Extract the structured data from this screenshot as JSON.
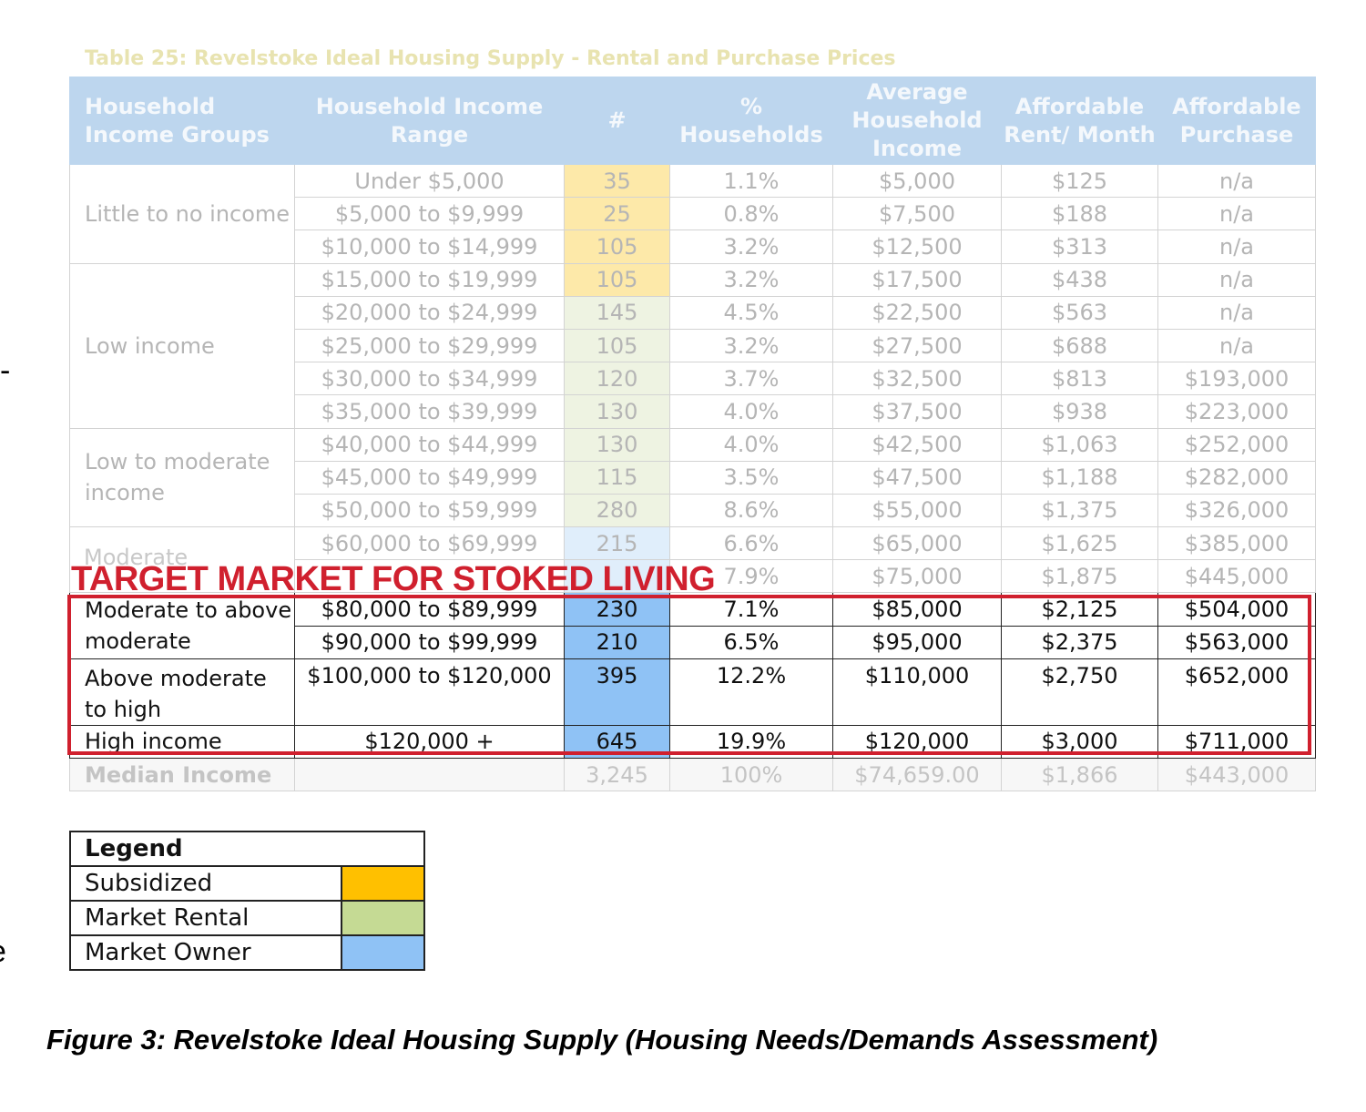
{
  "table_title": "Table 25: Revelstoke Ideal Housing Supply - Rental and Purchase Prices",
  "headers": [
    "Household Income Groups",
    "Household Income Range",
    "#",
    "% Households",
    "Average Household Income",
    "Affordable Rent/ Month",
    "Affordable Purchase"
  ],
  "groups": {
    "little": "Little to no income",
    "low": "Low income",
    "lowmod": "Low to moderate income",
    "moderate": "Moderate",
    "modabove": "Moderate to above moderate",
    "abovehigh": "Above moderate to high",
    "high": "High income"
  },
  "rows": [
    {
      "range": "Under $5,000",
      "count": "35",
      "pct": "1.1%",
      "avg": "$5,000",
      "rent": "$125",
      "purchase": "n/a"
    },
    {
      "range": "$5,000 to $9,999",
      "count": "25",
      "pct": "0.8%",
      "avg": "$7,500",
      "rent": "$188",
      "purchase": "n/a"
    },
    {
      "range": "$10,000 to $14,999",
      "count": "105",
      "pct": "3.2%",
      "avg": "$12,500",
      "rent": "$313",
      "purchase": "n/a"
    },
    {
      "range": "$15,000 to $19,999",
      "count": "105",
      "pct": "3.2%",
      "avg": "$17,500",
      "rent": "$438",
      "purchase": "n/a"
    },
    {
      "range": "$20,000 to $24,999",
      "count": "145",
      "pct": "4.5%",
      "avg": "$22,500",
      "rent": "$563",
      "purchase": "n/a"
    },
    {
      "range": "$25,000 to $29,999",
      "count": "105",
      "pct": "3.2%",
      "avg": "$27,500",
      "rent": "$688",
      "purchase": "n/a"
    },
    {
      "range": "$30,000 to $34,999",
      "count": "120",
      "pct": "3.7%",
      "avg": "$32,500",
      "rent": "$813",
      "purchase": "$193,000"
    },
    {
      "range": "$35,000 to $39,999",
      "count": "130",
      "pct": "4.0%",
      "avg": "$37,500",
      "rent": "$938",
      "purchase": "$223,000"
    },
    {
      "range": "$40,000 to $44,999",
      "count": "130",
      "pct": "4.0%",
      "avg": "$42,500",
      "rent": "$1,063",
      "purchase": "$252,000"
    },
    {
      "range": "$45,000 to $49,999",
      "count": "115",
      "pct": "3.5%",
      "avg": "$47,500",
      "rent": "$1,188",
      "purchase": "$282,000"
    },
    {
      "range": "$50,000 to $59,999",
      "count": "280",
      "pct": "8.6%",
      "avg": "$55,000",
      "rent": "$1,375",
      "purchase": "$326,000"
    },
    {
      "range": "$60,000 to $69,999",
      "count": "215",
      "pct": "6.6%",
      "avg": "$65,000",
      "rent": "$1,625",
      "purchase": "$385,000"
    },
    {
      "range": "",
      "count": "",
      "pct": "7.9%",
      "avg": "$75,000",
      "rent": "$1,875",
      "purchase": "$445,000"
    },
    {
      "range": "$80,000 to $89,999",
      "count": "230",
      "pct": "7.1%",
      "avg": "$85,000",
      "rent": "$2,125",
      "purchase": "$504,000"
    },
    {
      "range": "$90,000 to $99,999",
      "count": "210",
      "pct": "6.5%",
      "avg": "$95,000",
      "rent": "$2,375",
      "purchase": "$563,000"
    },
    {
      "range": "$100,000 to $120,000",
      "count": "395",
      "pct": "12.2%",
      "avg": "$110,000",
      "rent": "$2,750",
      "purchase": "$652,000"
    },
    {
      "range": "$120,000 +",
      "count": "645",
      "pct": "19.9%",
      "avg": "$120,000",
      "rent": "$3,000",
      "purchase": "$711,000"
    }
  ],
  "median": {
    "label": "Median Income",
    "count": "3,245",
    "pct": "100%",
    "avg": "$74,659.00",
    "rent": "$1,866",
    "purchase": "$443,000"
  },
  "target_label": "TARGET MARKET FOR STOKED LIVING",
  "legend": {
    "title": "Legend",
    "items": [
      {
        "label": "Subsidized",
        "color": "#ffc000"
      },
      {
        "label": "Market Rental",
        "color": "#c5da94"
      },
      {
        "label": "Market Owner",
        "color": "#8fc2f5"
      }
    ]
  },
  "caption": "Figure 3: Revelstoke Ideal Housing Supply (Housing Needs/Demands Assessment)"
}
